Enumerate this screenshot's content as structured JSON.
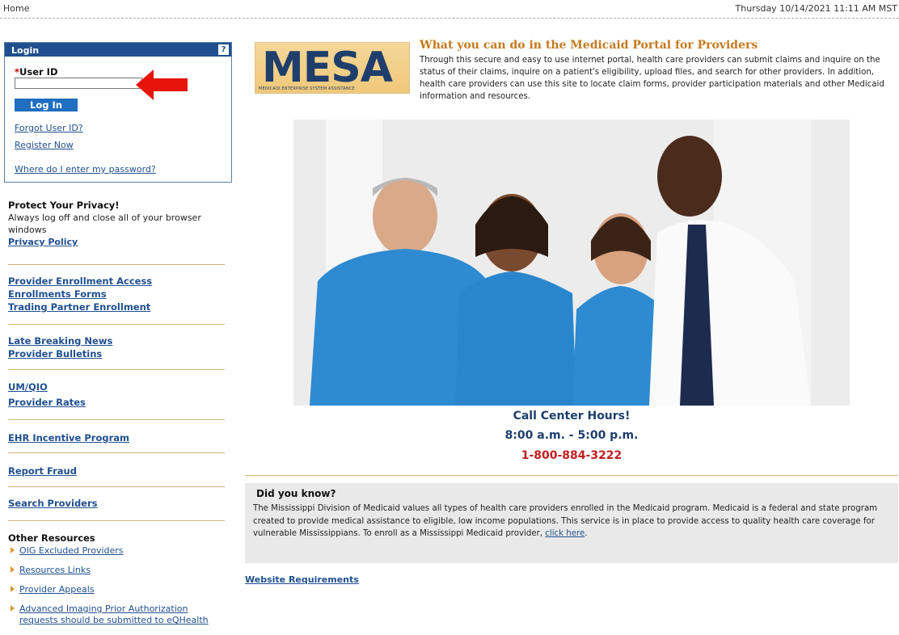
{
  "topbar": {
    "home": "Home",
    "datetime": "Thursday 10/14/2021 11:11 AM MST"
  },
  "login": {
    "title": "Login",
    "help": "?",
    "required_mark": "*",
    "user_id_label": "User ID",
    "user_id_value": "",
    "login_button": "Log In",
    "forgot_user_id": "Forgot User ID?",
    "register_now": "Register Now",
    "password_help": "Where do I enter my password?"
  },
  "sidebar": {
    "privacy_title": "Protect Your Privacy!",
    "privacy_text": "Always log off and close all of your browser windows",
    "privacy_policy": "Privacy Policy",
    "enrollment_links": [
      "Provider Enrollment Access",
      "Enrollments Forms",
      "Trading Partner Enrollment"
    ],
    "news_links": [
      "Late Breaking News",
      "Provider Bulletins"
    ],
    "qio_links": [
      "UM/QIO",
      "Provider Rates"
    ],
    "ehr": "EHR Incentive Program",
    "fraud": "Report Fraud",
    "search": "Search Providers",
    "other_resources_title": "Other Resources",
    "other_resources": [
      "OIG Excluded Providers",
      "Resources Links",
      "Provider Appeals",
      "Advanced Imaging Prior Authorization requests should be submitted to eQHealth"
    ]
  },
  "main": {
    "logo_text": "MESA",
    "logo_tagline": "MEDICAID ENTERPRISE SYSTEM ASSISTANCE",
    "intro_title": "What you can do in the Medicaid Portal for Providers",
    "intro_text": "Through this secure and easy to use internet portal, health care providers can submit claims and inquire on the status of their claims, inquire on a patient's eligibility, upload files, and search for other providers. In addition, health care providers can use this site to locate claim forms, provider participation materials and other Medicaid information and resources.",
    "call_center_title": "Call Center Hours!",
    "call_center_hours": "8:00 a.m. - 5:00 p.m.",
    "call_center_phone": "1-800-884-3222",
    "did_you_know_title": "Did you know?",
    "did_you_know_text": "The Mississippi Division of Medicaid values all types of health care providers enrolled in the Medicaid program. Medicaid is a federal and state program created to provide medical assistance to eligible, low income populations. This service is in place to provide access to quality health care coverage for vulnerable Mississippians. To enroll as a Mississippi Medicaid provider,",
    "click_here": "click here",
    "website_requirements": "Website Requirements"
  },
  "colors": {
    "header_blue": "#1f4f8f",
    "accent_orange": "#c47a1c",
    "phone_red": "#c02020",
    "arrow_red": "#e8140c"
  }
}
